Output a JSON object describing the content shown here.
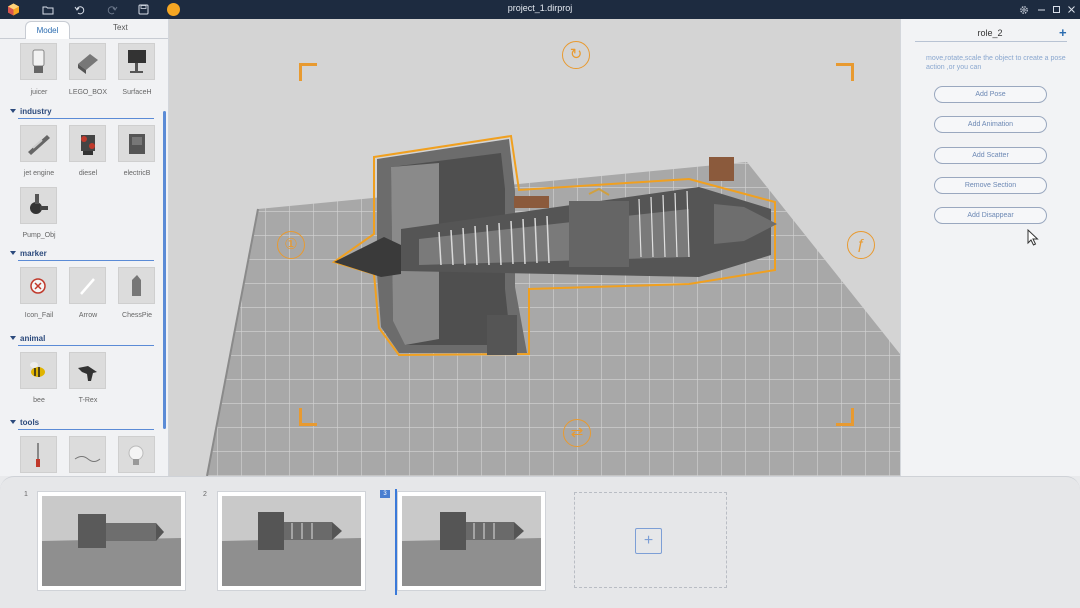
{
  "window": {
    "title": "project_1.dirproj",
    "play_color": "#f5a623"
  },
  "library": {
    "tabs": [
      {
        "label": "Model",
        "active": true
      },
      {
        "label": "Text",
        "active": false
      }
    ],
    "top_items": [
      {
        "label": "juicer",
        "icon": "juicer-icon"
      },
      {
        "label": "LEGO_BOX",
        "icon": "lego-box-icon"
      },
      {
        "label": "SurfaceH",
        "icon": "surfaceh-icon"
      }
    ],
    "categories": [
      {
        "name": "industry",
        "items": [
          {
            "label": "jet engine",
            "icon": "jet-engine-icon"
          },
          {
            "label": "diesel",
            "icon": "diesel-icon"
          },
          {
            "label": "electricB",
            "icon": "electricb-icon"
          },
          {
            "label": "Pump_Obj",
            "icon": "pump-icon"
          }
        ]
      },
      {
        "name": "marker",
        "items": [
          {
            "label": "Icon_Fail",
            "icon": "fail-icon"
          },
          {
            "label": "Arrow",
            "icon": "arrow-icon"
          },
          {
            "label": "ChessPie",
            "icon": "chess-piece-icon"
          }
        ]
      },
      {
        "name": "animal",
        "items": [
          {
            "label": "bee",
            "icon": "bee-icon"
          },
          {
            "label": "T-Rex",
            "icon": "trex-icon"
          }
        ]
      },
      {
        "name": "tools",
        "items": [
          {
            "label": "",
            "icon": "screwdriver-icon"
          },
          {
            "label": "",
            "icon": "cable-icon"
          },
          {
            "label": "",
            "icon": "bulb-icon"
          }
        ]
      }
    ]
  },
  "viewport": {
    "accent": "#e89a30",
    "gizmo_icons": [
      "rotate-icon",
      "tilt-left-icon",
      "tilt-right-icon",
      "spin-icon"
    ]
  },
  "inspector": {
    "role_title": "role_2",
    "hint": "move,rotate,scale the object to create a pose action ,or you can",
    "actions": [
      {
        "label": "Add Pose"
      },
      {
        "label": "Add Animation"
      },
      {
        "label": "Add Scatter"
      },
      {
        "label": "Remove Section"
      },
      {
        "label": "Add Disappear"
      }
    ]
  },
  "timeline": {
    "frames": [
      {
        "number": "1"
      },
      {
        "number": "2"
      },
      {
        "number": "3"
      }
    ]
  }
}
